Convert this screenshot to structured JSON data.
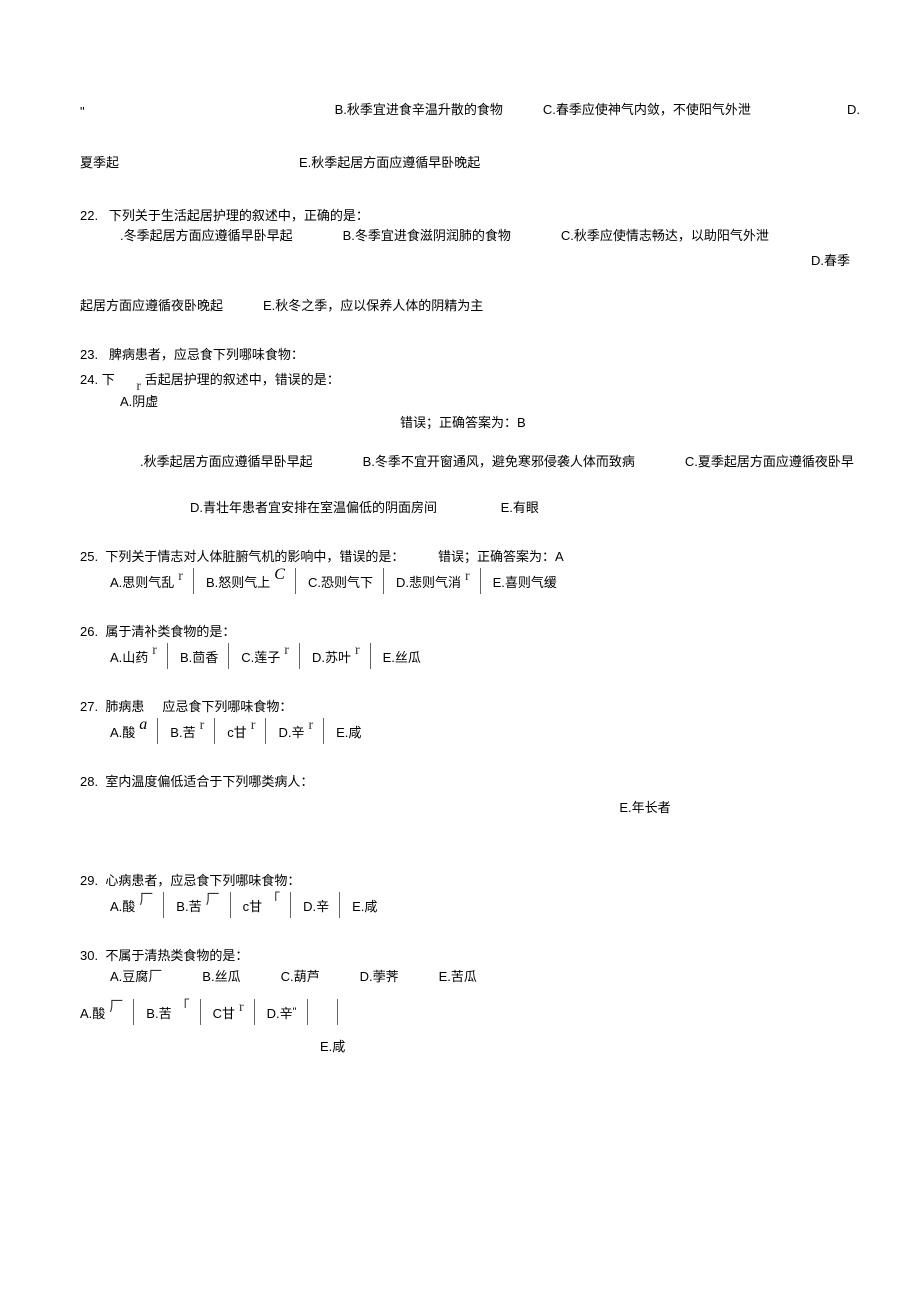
{
  "top": {
    "quote": "\"",
    "b": "B.秋季宜进食辛温升散的食物",
    "c": "C.春季应使神气内敛，不使阳气外泄",
    "d": "D."
  },
  "top2": {
    "left": "夏季起",
    "e": "E.秋季起居方面应遵循早卧晚起"
  },
  "q22": {
    "num": "22.",
    "stem": "下列关于生活起居护理的叙述中，正确的是：",
    "a": ".冬季起居方面应遵循早卧早起",
    "b": "B.冬季宜进食滋阴润肺的食物",
    "c": "C.秋季应使情志畅达，以助阳气外泄",
    "d": "D.春季",
    "line2a": "起居方面应遵循夜卧晚起",
    "line2e": "E.秋冬之季，应以保养人体的阴精为主"
  },
  "q23": {
    "num": "23.",
    "stem": "脾病患者，应忌食下列哪味食物："
  },
  "q24": {
    "num": "24.",
    "prefix": "下",
    "mid_radio": "r",
    "stem": "舌起居护理的叙述中，错误的是：",
    "a": "A.阴虚",
    "err": "错误；正确答案为：B",
    "opt_a": ".秋季起居方面应遵循早卧早起",
    "opt_b": "B.冬季不宜开窗通风，避免寒邪侵袭人体而致病",
    "opt_c": "C.夏季起居方面应遵循夜卧早",
    "opt_d": "D.青壮年患者宜安排在室温偏低的阴面房间",
    "opt_e": "E.有眼"
  },
  "q25": {
    "num": "25.",
    "stem": "下列关于情志对人体脏腑气机的影响中，错误的是：",
    "err": "错误；正确答案为：A",
    "a": "A.思则气乱",
    "b": "B.怒则气上",
    "c": "C.恐则气下",
    "d": "D.悲则气消",
    "e": "E.喜则气缓",
    "r": "r",
    "C": "C"
  },
  "q26": {
    "num": "26.",
    "stem": "属于清补类食物的是：",
    "a": "A.山药",
    "b": "B.茴香",
    "c": "C.莲子",
    "d": "D.苏叶",
    "e": "E.丝瓜",
    "r": "r"
  },
  "q27": {
    "num": "27.",
    "stem_left": "肺病患",
    "stem_right": "应忌食下列哪味食物：",
    "a": "A.酸",
    "aa": "a",
    "b": "B.苦",
    "c": "c甘",
    "d": "D.辛",
    "e": "E.咸",
    "r": "r"
  },
  "q28": {
    "num": "28.",
    "stem": "室内温度偏低适合于下列哪类病人：",
    "e": "E.年长者"
  },
  "q29": {
    "num": "29.",
    "stem": "心病患者，应忌食下列哪味食物：",
    "a": "A.酸",
    "b": "B.苦",
    "c": "c甘",
    "d": "D.辛",
    "e": "E.咸",
    "r": "「",
    "r2": "厂"
  },
  "q30": {
    "num": "30.",
    "stem": "不属于清热类食物的是：",
    "a": "A.豆腐",
    "b": "B.丝瓜",
    "c": "C.葫芦",
    "d": "D.荸荠",
    "e": "E.苦瓜",
    "r2": "厂",
    "a2": "A.酸",
    "b2": "B.苦",
    "c2": "C甘",
    "d2": "D.辛",
    "r": "r",
    "q": "\"",
    "r3": "「",
    "ee": "E.咸"
  }
}
